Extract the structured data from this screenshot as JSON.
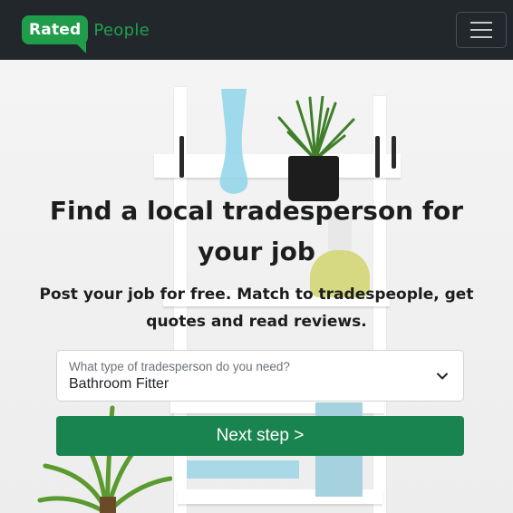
{
  "brand": {
    "badge": "Rated",
    "word": "People"
  },
  "hero": {
    "headline": "Find a local tradesperson for your job",
    "subheadline": "Post your job for free. Match to tradespeople, get quotes and read reviews."
  },
  "form": {
    "trade_label": "What type of tradesperson do you need?",
    "trade_value": "Bathroom Fitter",
    "next_button": "Next step >"
  },
  "colors": {
    "navbar": "#22272c",
    "brand_green": "#1f9d4a",
    "button_green": "#1a8450"
  },
  "icons": {
    "menu": "hamburger-menu-icon",
    "dropdown": "chevron-down-icon"
  }
}
